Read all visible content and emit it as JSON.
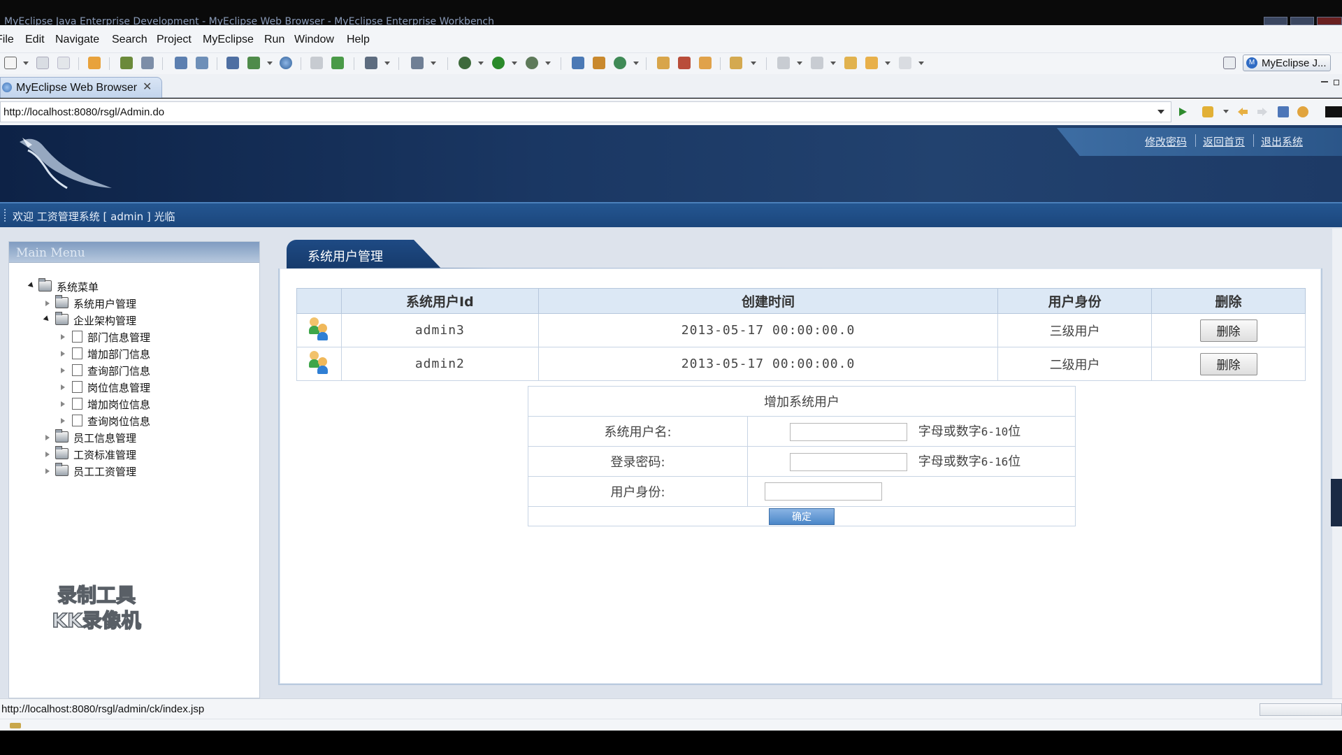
{
  "window": {
    "title": "MyEclipse Java Enterprise Development - MyEclipse Web Browser - MyEclipse Enterprise Workbench"
  },
  "menubar": {
    "items": [
      "File",
      "Edit",
      "Navigate",
      "Search",
      "Project",
      "MyEclipse",
      "Run",
      "Window",
      "Help"
    ]
  },
  "perspective": {
    "label": "MyEclipse J..."
  },
  "editor_tab": {
    "label": "MyEclipse Web Browser",
    "close": "✕"
  },
  "address": {
    "url": "http://localhost:8080/rsgl/Admin.do"
  },
  "banner": {
    "links": [
      "修改密码",
      "返回首页",
      "退出系统"
    ]
  },
  "welcome": {
    "text": "欢迎 工资管理系统 [ admin ] 光临"
  },
  "left_menu": {
    "title": "Main Menu",
    "root": "系统菜单",
    "items": [
      {
        "label": "系统用户管理"
      },
      {
        "label": "企业架构管理",
        "children": [
          "部门信息管理",
          "增加部门信息",
          "查询部门信息",
          "岗位信息管理",
          "增加岗位信息",
          "查询岗位信息"
        ]
      },
      {
        "label": "员工信息管理"
      },
      {
        "label": "工资标准管理"
      },
      {
        "label": "员工工资管理"
      }
    ]
  },
  "watermark": {
    "line1": "录制工具",
    "line2": "KK录像机"
  },
  "main": {
    "tab_title": "系统用户管理",
    "table": {
      "headers": [
        "",
        "系统用户Id",
        "创建时间",
        "用户身份",
        "删除"
      ],
      "rows": [
        {
          "id": "admin3",
          "created": "2013-05-17 00:00:00.0",
          "role": "三级用户",
          "action": "删除"
        },
        {
          "id": "admin2",
          "created": "2013-05-17 00:00:00.0",
          "role": "二级用户",
          "action": "删除"
        }
      ]
    },
    "form": {
      "title": "增加系统用户",
      "username_label": "系统用户名:",
      "username_hint_a": "字母或数字",
      "username_hint_b": "6-10",
      "username_hint_c": "位",
      "password_label": "登录密码:",
      "password_hint_a": "字母或数字",
      "password_hint_b": "6-16",
      "password_hint_c": "位",
      "role_label": "用户身份:",
      "submit": "确定"
    }
  },
  "status": {
    "url": "http://localhost:8080/rsgl/admin/ck/index.jsp"
  }
}
